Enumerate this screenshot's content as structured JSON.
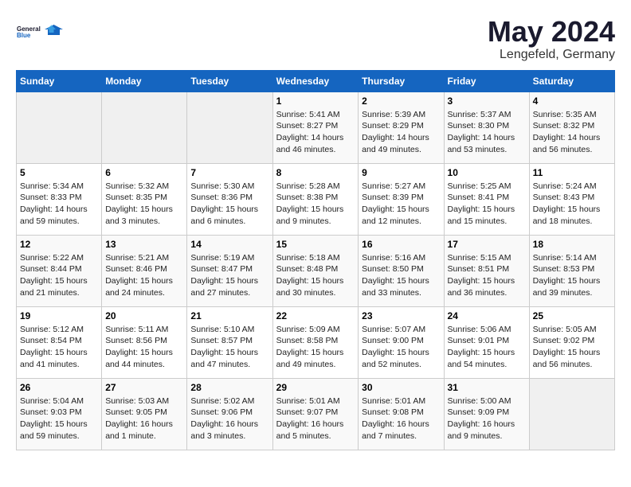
{
  "logo": {
    "line1": "General",
    "line2": "Blue"
  },
  "title": "May 2024",
  "location": "Lengefeld, Germany",
  "days_header": [
    "Sunday",
    "Monday",
    "Tuesday",
    "Wednesday",
    "Thursday",
    "Friday",
    "Saturday"
  ],
  "weeks": [
    [
      {
        "day": "",
        "info": ""
      },
      {
        "day": "",
        "info": ""
      },
      {
        "day": "",
        "info": ""
      },
      {
        "day": "1",
        "info": "Sunrise: 5:41 AM\nSunset: 8:27 PM\nDaylight: 14 hours\nand 46 minutes."
      },
      {
        "day": "2",
        "info": "Sunrise: 5:39 AM\nSunset: 8:29 PM\nDaylight: 14 hours\nand 49 minutes."
      },
      {
        "day": "3",
        "info": "Sunrise: 5:37 AM\nSunset: 8:30 PM\nDaylight: 14 hours\nand 53 minutes."
      },
      {
        "day": "4",
        "info": "Sunrise: 5:35 AM\nSunset: 8:32 PM\nDaylight: 14 hours\nand 56 minutes."
      }
    ],
    [
      {
        "day": "5",
        "info": "Sunrise: 5:34 AM\nSunset: 8:33 PM\nDaylight: 14 hours\nand 59 minutes."
      },
      {
        "day": "6",
        "info": "Sunrise: 5:32 AM\nSunset: 8:35 PM\nDaylight: 15 hours\nand 3 minutes."
      },
      {
        "day": "7",
        "info": "Sunrise: 5:30 AM\nSunset: 8:36 PM\nDaylight: 15 hours\nand 6 minutes."
      },
      {
        "day": "8",
        "info": "Sunrise: 5:28 AM\nSunset: 8:38 PM\nDaylight: 15 hours\nand 9 minutes."
      },
      {
        "day": "9",
        "info": "Sunrise: 5:27 AM\nSunset: 8:39 PM\nDaylight: 15 hours\nand 12 minutes."
      },
      {
        "day": "10",
        "info": "Sunrise: 5:25 AM\nSunset: 8:41 PM\nDaylight: 15 hours\nand 15 minutes."
      },
      {
        "day": "11",
        "info": "Sunrise: 5:24 AM\nSunset: 8:43 PM\nDaylight: 15 hours\nand 18 minutes."
      }
    ],
    [
      {
        "day": "12",
        "info": "Sunrise: 5:22 AM\nSunset: 8:44 PM\nDaylight: 15 hours\nand 21 minutes."
      },
      {
        "day": "13",
        "info": "Sunrise: 5:21 AM\nSunset: 8:46 PM\nDaylight: 15 hours\nand 24 minutes."
      },
      {
        "day": "14",
        "info": "Sunrise: 5:19 AM\nSunset: 8:47 PM\nDaylight: 15 hours\nand 27 minutes."
      },
      {
        "day": "15",
        "info": "Sunrise: 5:18 AM\nSunset: 8:48 PM\nDaylight: 15 hours\nand 30 minutes."
      },
      {
        "day": "16",
        "info": "Sunrise: 5:16 AM\nSunset: 8:50 PM\nDaylight: 15 hours\nand 33 minutes."
      },
      {
        "day": "17",
        "info": "Sunrise: 5:15 AM\nSunset: 8:51 PM\nDaylight: 15 hours\nand 36 minutes."
      },
      {
        "day": "18",
        "info": "Sunrise: 5:14 AM\nSunset: 8:53 PM\nDaylight: 15 hours\nand 39 minutes."
      }
    ],
    [
      {
        "day": "19",
        "info": "Sunrise: 5:12 AM\nSunset: 8:54 PM\nDaylight: 15 hours\nand 41 minutes."
      },
      {
        "day": "20",
        "info": "Sunrise: 5:11 AM\nSunset: 8:56 PM\nDaylight: 15 hours\nand 44 minutes."
      },
      {
        "day": "21",
        "info": "Sunrise: 5:10 AM\nSunset: 8:57 PM\nDaylight: 15 hours\nand 47 minutes."
      },
      {
        "day": "22",
        "info": "Sunrise: 5:09 AM\nSunset: 8:58 PM\nDaylight: 15 hours\nand 49 minutes."
      },
      {
        "day": "23",
        "info": "Sunrise: 5:07 AM\nSunset: 9:00 PM\nDaylight: 15 hours\nand 52 minutes."
      },
      {
        "day": "24",
        "info": "Sunrise: 5:06 AM\nSunset: 9:01 PM\nDaylight: 15 hours\nand 54 minutes."
      },
      {
        "day": "25",
        "info": "Sunrise: 5:05 AM\nSunset: 9:02 PM\nDaylight: 15 hours\nand 56 minutes."
      }
    ],
    [
      {
        "day": "26",
        "info": "Sunrise: 5:04 AM\nSunset: 9:03 PM\nDaylight: 15 hours\nand 59 minutes."
      },
      {
        "day": "27",
        "info": "Sunrise: 5:03 AM\nSunset: 9:05 PM\nDaylight: 16 hours\nand 1 minute."
      },
      {
        "day": "28",
        "info": "Sunrise: 5:02 AM\nSunset: 9:06 PM\nDaylight: 16 hours\nand 3 minutes."
      },
      {
        "day": "29",
        "info": "Sunrise: 5:01 AM\nSunset: 9:07 PM\nDaylight: 16 hours\nand 5 minutes."
      },
      {
        "day": "30",
        "info": "Sunrise: 5:01 AM\nSunset: 9:08 PM\nDaylight: 16 hours\nand 7 minutes."
      },
      {
        "day": "31",
        "info": "Sunrise: 5:00 AM\nSunset: 9:09 PM\nDaylight: 16 hours\nand 9 minutes."
      },
      {
        "day": "",
        "info": ""
      }
    ]
  ]
}
